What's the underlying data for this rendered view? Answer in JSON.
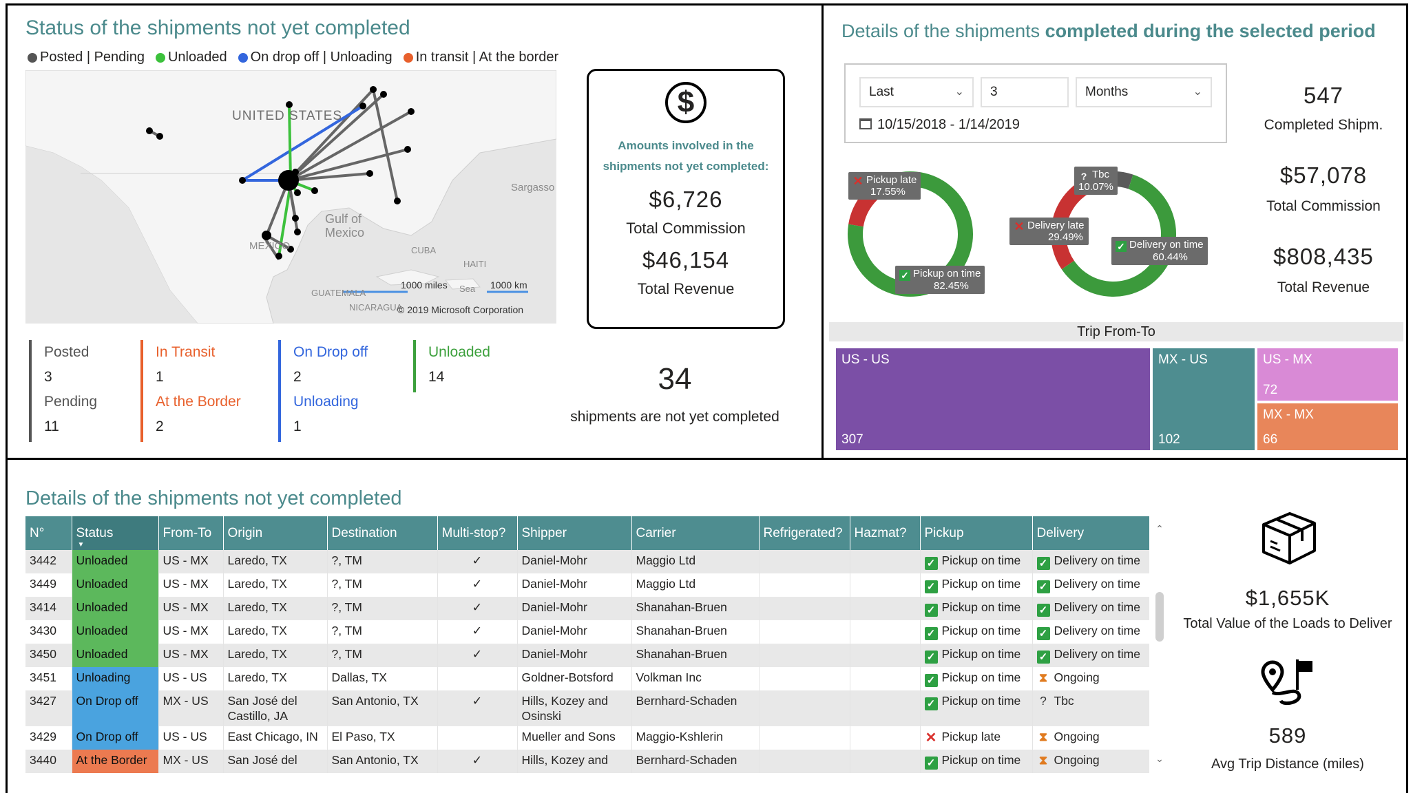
{
  "left_top": {
    "title": "Status of the shipments not yet completed",
    "legend": [
      {
        "label": "Posted | Pending",
        "color": "#555555"
      },
      {
        "label": "Unloaded",
        "color": "#3cc13c"
      },
      {
        "label": "On drop off | Unloading",
        "color": "#3366dd"
      },
      {
        "label": "In transit | At the border",
        "color": "#e8602c"
      }
    ],
    "map": {
      "labels": {
        "us": "UNITED STATES",
        "gulf1": "Gulf of",
        "gulf2": "Mexico",
        "sargasso": "Sargasso",
        "mexico": "MEXICO",
        "cuba": "CUBA",
        "haiti": "HAITI",
        "guate": "GUATEMALA",
        "nica": "NICARAGUA",
        "sea": "Sea",
        "scale_miles": "1000 miles",
        "scale_km": "1000 km",
        "copyright": "© 2019 Microsoft Corporation"
      }
    },
    "card": {
      "icon": "dollar-icon",
      "caption": "Amounts involved in the shipments not yet completed:",
      "commission_value": "$6,726",
      "commission_label": "Total Commission",
      "revenue_value": "$46,154",
      "revenue_label": "Total Revenue"
    },
    "status_groups": [
      {
        "label1": "Posted",
        "value1": "3",
        "label2": "Pending",
        "value2": "11",
        "color": "#555555"
      },
      {
        "label1": "In Transit",
        "value1": "1",
        "label2": "At the Border",
        "value2": "2",
        "color": "#e8602c"
      },
      {
        "label1": "On Drop off",
        "value1": "2",
        "label2": "Unloading",
        "value2": "1",
        "color": "#3366dd"
      },
      {
        "label1": "Unloaded",
        "value1": "14",
        "label2": "",
        "value2": "",
        "color": "#3ca03c"
      }
    ],
    "total_not_completed": "34",
    "total_caption": "shipments are not yet completed"
  },
  "right_top": {
    "title_pre": "Details of the shipments ",
    "title_bold": "completed during the selected period",
    "filter": {
      "mode": "Last",
      "amount": "3",
      "unit": "Months",
      "range": "10/15/2018 - 1/14/2019"
    },
    "kpis": [
      {
        "value": "547",
        "label": "Completed Shipm."
      },
      {
        "value": "$57,078",
        "label": "Total Commission"
      },
      {
        "value": "$808,435",
        "label": "Total Revenue"
      }
    ],
    "donuts": {
      "pickup": {
        "late_label": "Pickup late",
        "late_pct": "17.55%",
        "late_value": 17.55,
        "ontime_label": "Pickup on time",
        "ontime_pct": "82.45%",
        "ontime_value": 82.45
      },
      "delivery": {
        "tbc_label": "Tbc",
        "tbc_pct": "10.07%",
        "tbc_value": 10.07,
        "late_label": "Delivery late",
        "late_pct": "29.49%",
        "late_value": 29.49,
        "ontime_label": "Delivery on time",
        "ontime_pct": "60.44%",
        "ontime_value": 60.44
      },
      "colors": {
        "ontime": "#3c9a3c",
        "late": "#c83232",
        "tbc": "#5a5a5a"
      }
    },
    "treemap": {
      "title": "Trip From-To",
      "cells": [
        {
          "label": "US - US",
          "value": "307",
          "color": "#7b4fa6"
        },
        {
          "label": "MX - US",
          "value": "102",
          "color": "#4e8d90"
        },
        {
          "label": "US - MX",
          "value": "72",
          "color": "#d98ad6"
        },
        {
          "label": "MX - MX",
          "value": "66",
          "color": "#e8865a"
        }
      ]
    }
  },
  "bottom": {
    "title": "Details of the shipments not yet completed",
    "columns": [
      "N°",
      "Status",
      "From-To",
      "Origin",
      "Destination",
      "Multi-stop?",
      "Shipper",
      "Carrier",
      "Refrigerated?",
      "Hazmat?",
      "Pickup",
      "Delivery"
    ],
    "status_colors": {
      "Unloaded": "#5cb85c",
      "Unloading": "#4aa3df",
      "On Drop off": "#4aa3df",
      "At the Border": "#ec7a50"
    },
    "rows": [
      {
        "n": "3442",
        "status": "Unloaded",
        "fromto": "US - MX",
        "origin": "Laredo, TX",
        "dest": "?, TM",
        "multi": "✓",
        "shipper": "Daniel-Mohr",
        "carrier": "Maggio Ltd",
        "pickup": "Pickup on time",
        "pickup_icon": "ok",
        "delivery": "Delivery on time",
        "delivery_icon": "ok"
      },
      {
        "n": "3449",
        "status": "Unloaded",
        "fromto": "US - MX",
        "origin": "Laredo, TX",
        "dest": "?, TM",
        "multi": "✓",
        "shipper": "Daniel-Mohr",
        "carrier": "Maggio Ltd",
        "pickup": "Pickup on time",
        "pickup_icon": "ok",
        "delivery": "Delivery on time",
        "delivery_icon": "ok"
      },
      {
        "n": "3414",
        "status": "Unloaded",
        "fromto": "US - MX",
        "origin": "Laredo, TX",
        "dest": "?, TM",
        "multi": "✓",
        "shipper": "Daniel-Mohr",
        "carrier": "Shanahan-Bruen",
        "pickup": "Pickup on time",
        "pickup_icon": "ok",
        "delivery": "Delivery on time",
        "delivery_icon": "ok"
      },
      {
        "n": "3430",
        "status": "Unloaded",
        "fromto": "US - MX",
        "origin": "Laredo, TX",
        "dest": "?, TM",
        "multi": "✓",
        "shipper": "Daniel-Mohr",
        "carrier": "Shanahan-Bruen",
        "pickup": "Pickup on time",
        "pickup_icon": "ok",
        "delivery": "Delivery on time",
        "delivery_icon": "ok"
      },
      {
        "n": "3450",
        "status": "Unloaded",
        "fromto": "US - MX",
        "origin": "Laredo, TX",
        "dest": "?, TM",
        "multi": "✓",
        "shipper": "Daniel-Mohr",
        "carrier": "Shanahan-Bruen",
        "pickup": "Pickup on time",
        "pickup_icon": "ok",
        "delivery": "Delivery on time",
        "delivery_icon": "ok"
      },
      {
        "n": "3451",
        "status": "Unloading",
        "fromto": "US - US",
        "origin": "Laredo, TX",
        "dest": "Dallas, TX",
        "multi": "",
        "shipper": "Goldner-Botsford",
        "carrier": "Volkman Inc",
        "pickup": "Pickup on time",
        "pickup_icon": "ok",
        "delivery": "Ongoing",
        "delivery_icon": "hourglass"
      },
      {
        "n": "3427",
        "status": "On Drop off",
        "fromto": "MX - US",
        "origin": "San José del Castillo, JA",
        "dest": "San Antonio, TX",
        "multi": "✓",
        "shipper": "Hills, Kozey and Osinski",
        "carrier": "Bernhard-Schaden",
        "pickup": "Pickup on time",
        "pickup_icon": "ok",
        "delivery": "Tbc",
        "delivery_icon": "question"
      },
      {
        "n": "3429",
        "status": "On Drop off",
        "fromto": "US - US",
        "origin": "East Chicago, IN",
        "dest": "El Paso, TX",
        "multi": "",
        "shipper": "Mueller and Sons",
        "carrier": "Maggio-Kshlerin",
        "pickup": "Pickup late",
        "pickup_icon": "bad",
        "delivery": "Ongoing",
        "delivery_icon": "hourglass"
      },
      {
        "n": "3440",
        "status": "At the Border",
        "fromto": "MX - US",
        "origin": "San José del",
        "dest": "San Antonio, TX",
        "multi": "✓",
        "shipper": "Hills, Kozey and",
        "carrier": "Bernhard-Schaden",
        "pickup": "Pickup on time",
        "pickup_icon": "ok",
        "delivery": "Ongoing",
        "delivery_icon": "hourglass"
      }
    ]
  },
  "right_bottom": {
    "load_icon": "package-icon",
    "load_value": "$1,655K",
    "load_label": "Total Value of the Loads to Deliver",
    "trip_icon": "route-icon",
    "trip_value": "589",
    "trip_label": "Avg Trip Distance (miles)"
  }
}
